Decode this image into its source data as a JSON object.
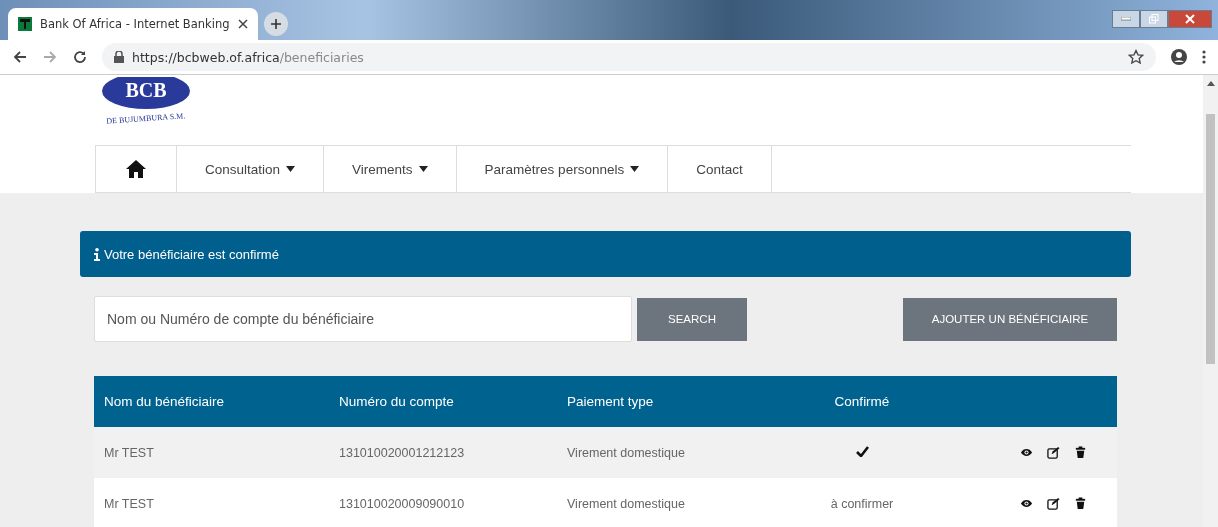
{
  "browser": {
    "tab_title": "Bank Of Africa - Internet Banking",
    "url_host": "https://bcbweb.of.africa",
    "url_path": "/beneficiaries"
  },
  "logo": {
    "name": "BCB",
    "subtitle": "DE BUJUMBURA S.M."
  },
  "nav": [
    {
      "label": "Consultation",
      "dropdown": true
    },
    {
      "label": "Virements",
      "dropdown": true
    },
    {
      "label": "Paramètres personnels",
      "dropdown": true
    },
    {
      "label": "Contact",
      "dropdown": false
    }
  ],
  "alert": {
    "message": "Votre bénéficiaire est confirmé"
  },
  "search": {
    "placeholder": "Nom ou Numéro de compte du bénéficiaire",
    "button": "SEARCH"
  },
  "add_button": "AJOUTER UN BÉNÉFICIAIRE",
  "table": {
    "columns": [
      "Nom du bénéficiaire",
      "Numéro du compte",
      "Paiement type",
      "Confirmé"
    ],
    "rows": [
      {
        "name": "Mr TEST",
        "account": "131010020001212123",
        "payment_type": "Virement domestique",
        "confirmed": true
      },
      {
        "name": "Mr TEST",
        "account": "131010020009090010",
        "payment_type": "Virement domestique",
        "confirmed": false,
        "pending_label": "à confirmer"
      }
    ]
  }
}
